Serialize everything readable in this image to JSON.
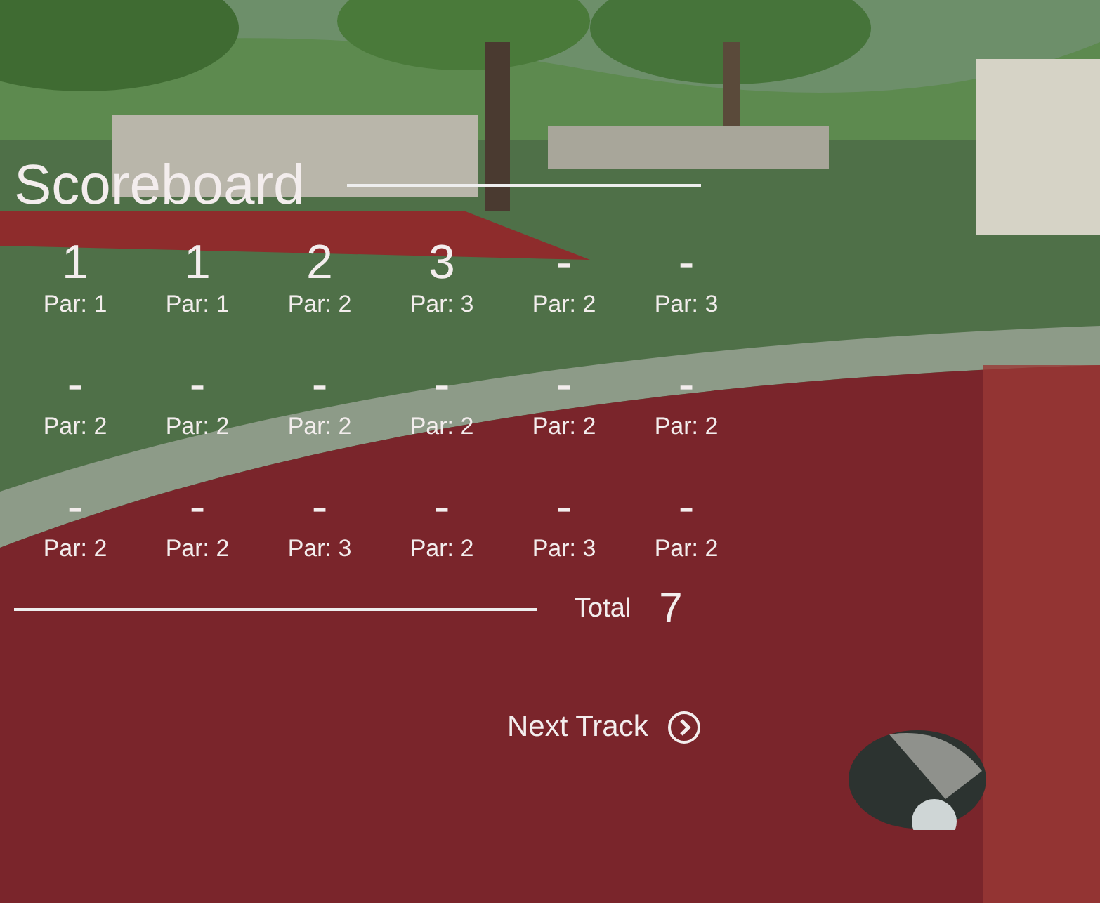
{
  "title": "Scoreboard",
  "holes": [
    {
      "score": "1",
      "par": "Par: 1"
    },
    {
      "score": "1",
      "par": "Par: 1"
    },
    {
      "score": "2",
      "par": "Par: 2"
    },
    {
      "score": "3",
      "par": "Par: 3"
    },
    {
      "score": "-",
      "par": "Par: 2"
    },
    {
      "score": "-",
      "par": "Par: 3"
    },
    {
      "score": "-",
      "par": "Par: 2"
    },
    {
      "score": "-",
      "par": "Par: 2"
    },
    {
      "score": "-",
      "par": "Par: 2"
    },
    {
      "score": "-",
      "par": "Par: 2"
    },
    {
      "score": "-",
      "par": "Par: 2"
    },
    {
      "score": "-",
      "par": "Par: 2"
    },
    {
      "score": "-",
      "par": "Par: 2"
    },
    {
      "score": "-",
      "par": "Par: 2"
    },
    {
      "score": "-",
      "par": "Par: 3"
    },
    {
      "score": "-",
      "par": "Par: 2"
    },
    {
      "score": "-",
      "par": "Par: 3"
    },
    {
      "score": "-",
      "par": "Par: 2"
    }
  ],
  "total": {
    "label": "Total",
    "value": "7"
  },
  "next_button": {
    "label": "Next Track"
  }
}
